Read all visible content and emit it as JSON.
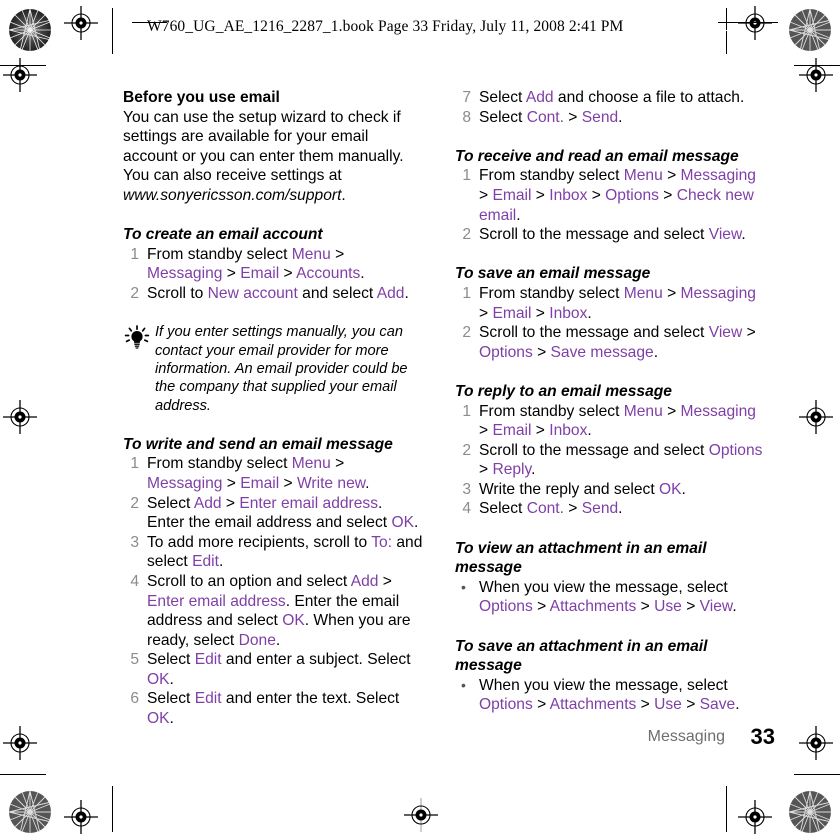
{
  "header": {
    "book_line": "W760_UG_AE_1216_2287_1.book  Page 33  Friday, July 11, 2008  2:41 PM"
  },
  "footer": {
    "chapter": "Messaging",
    "page_number": "33"
  },
  "colors": {
    "ui_term": "#7f3fa6",
    "step_number": "#8c8c8c",
    "chapter_text": "#6e6e6e",
    "body_text": "#000000"
  },
  "icons": {
    "tip": "lightbulb-icon",
    "registration": "registration-target-icon",
    "starburst": "starburst-density-icon"
  },
  "left_column": {
    "section_heading": "Before you use email",
    "intro_1": "You can use the setup wizard to check if settings are available for your email account or you can enter them manually. You can also receive settings at ",
    "intro_url": "www.sonyericsson.com/support",
    "intro_2": ".",
    "proc_1": {
      "title": "To create an email account",
      "steps": [
        {
          "num": "1",
          "parts": [
            {
              "t": "From standby select ",
              "s": "plain"
            },
            {
              "t": "Menu",
              "s": "ui"
            },
            {
              "t": " > ",
              "s": "plain"
            },
            {
              "t": "Messaging",
              "s": "ui"
            },
            {
              "t": " > ",
              "s": "plain"
            },
            {
              "t": "Email",
              "s": "ui"
            },
            {
              "t": " > ",
              "s": "plain"
            },
            {
              "t": "Accounts",
              "s": "ui"
            },
            {
              "t": ".",
              "s": "plain"
            }
          ]
        },
        {
          "num": "2",
          "parts": [
            {
              "t": "Scroll to ",
              "s": "plain"
            },
            {
              "t": "New account",
              "s": "ui"
            },
            {
              "t": " and select ",
              "s": "plain"
            },
            {
              "t": "Add",
              "s": "ui"
            },
            {
              "t": ".",
              "s": "plain"
            }
          ]
        }
      ]
    },
    "tip": "If you enter settings manually, you can contact your email provider for more information. An email provider could be the company that supplied your email address.",
    "proc_2": {
      "title": "To write and send an email message",
      "steps": [
        {
          "num": "1",
          "parts": [
            {
              "t": "From standby select ",
              "s": "plain"
            },
            {
              "t": "Menu",
              "s": "ui"
            },
            {
              "t": " > ",
              "s": "plain"
            },
            {
              "t": "Messaging",
              "s": "ui"
            },
            {
              "t": " > ",
              "s": "plain"
            },
            {
              "t": "Email",
              "s": "ui"
            },
            {
              "t": " > ",
              "s": "plain"
            },
            {
              "t": "Write new",
              "s": "ui"
            },
            {
              "t": ".",
              "s": "plain"
            }
          ]
        },
        {
          "num": "2",
          "parts": [
            {
              "t": "Select ",
              "s": "plain"
            },
            {
              "t": "Add",
              "s": "ui"
            },
            {
              "t": " > ",
              "s": "plain"
            },
            {
              "t": "Enter email address",
              "s": "ui"
            },
            {
              "t": ". Enter the email address and select ",
              "s": "plain"
            },
            {
              "t": "OK",
              "s": "ui"
            },
            {
              "t": ".",
              "s": "plain"
            }
          ]
        },
        {
          "num": "3",
          "parts": [
            {
              "t": "To add more recipients, scroll to ",
              "s": "plain"
            },
            {
              "t": "To:",
              "s": "ui"
            },
            {
              "t": " and select ",
              "s": "plain"
            },
            {
              "t": "Edit",
              "s": "ui"
            },
            {
              "t": ".",
              "s": "plain"
            }
          ]
        },
        {
          "num": "4",
          "parts": [
            {
              "t": "Scroll to an option and select ",
              "s": "plain"
            },
            {
              "t": "Add",
              "s": "ui"
            },
            {
              "t": " > ",
              "s": "plain"
            },
            {
              "t": "Enter email address",
              "s": "ui"
            },
            {
              "t": ". Enter the email address and select ",
              "s": "plain"
            },
            {
              "t": "OK",
              "s": "ui"
            },
            {
              "t": ". When you are ready, select ",
              "s": "plain"
            },
            {
              "t": "Done",
              "s": "ui"
            },
            {
              "t": ".",
              "s": "plain"
            }
          ]
        },
        {
          "num": "5",
          "parts": [
            {
              "t": "Select ",
              "s": "plain"
            },
            {
              "t": "Edit",
              "s": "ui"
            },
            {
              "t": " and enter a subject. Select ",
              "s": "plain"
            },
            {
              "t": "OK",
              "s": "ui"
            },
            {
              "t": ".",
              "s": "plain"
            }
          ]
        },
        {
          "num": "6",
          "parts": [
            {
              "t": "Select ",
              "s": "plain"
            },
            {
              "t": "Edit",
              "s": "ui"
            },
            {
              "t": " and enter the text. Select ",
              "s": "plain"
            },
            {
              "t": "OK",
              "s": "ui"
            },
            {
              "t": ".",
              "s": "plain"
            }
          ]
        }
      ]
    }
  },
  "right_column": {
    "proc_2_cont": {
      "steps": [
        {
          "num": "7",
          "parts": [
            {
              "t": "Select ",
              "s": "plain"
            },
            {
              "t": "Add",
              "s": "ui"
            },
            {
              "t": " and choose a file to attach.",
              "s": "plain"
            }
          ]
        },
        {
          "num": "8",
          "parts": [
            {
              "t": "Select ",
              "s": "plain"
            },
            {
              "t": "Cont.",
              "s": "ui"
            },
            {
              "t": " > ",
              "s": "plain"
            },
            {
              "t": "Send",
              "s": "ui"
            },
            {
              "t": ".",
              "s": "plain"
            }
          ]
        }
      ]
    },
    "proc_3": {
      "title": "To receive and read an email message",
      "steps": [
        {
          "num": "1",
          "parts": [
            {
              "t": "From standby select ",
              "s": "plain"
            },
            {
              "t": "Menu",
              "s": "ui"
            },
            {
              "t": " > ",
              "s": "plain"
            },
            {
              "t": "Messaging",
              "s": "ui"
            },
            {
              "t": " > ",
              "s": "plain"
            },
            {
              "t": "Email",
              "s": "ui"
            },
            {
              "t": " > ",
              "s": "plain"
            },
            {
              "t": "Inbox",
              "s": "ui"
            },
            {
              "t": " > ",
              "s": "plain"
            },
            {
              "t": "Options",
              "s": "ui"
            },
            {
              "t": " > ",
              "s": "plain"
            },
            {
              "t": "Check new email",
              "s": "ui"
            },
            {
              "t": ".",
              "s": "plain"
            }
          ]
        },
        {
          "num": "2",
          "parts": [
            {
              "t": "Scroll to the message and select ",
              "s": "plain"
            },
            {
              "t": "View",
              "s": "ui"
            },
            {
              "t": ".",
              "s": "plain"
            }
          ]
        }
      ]
    },
    "proc_4": {
      "title": "To save an email message",
      "steps": [
        {
          "num": "1",
          "parts": [
            {
              "t": "From standby select ",
              "s": "plain"
            },
            {
              "t": "Menu",
              "s": "ui"
            },
            {
              "t": " > ",
              "s": "plain"
            },
            {
              "t": "Messaging",
              "s": "ui"
            },
            {
              "t": " > ",
              "s": "plain"
            },
            {
              "t": "Email",
              "s": "ui"
            },
            {
              "t": " > ",
              "s": "plain"
            },
            {
              "t": "Inbox",
              "s": "ui"
            },
            {
              "t": ".",
              "s": "plain"
            }
          ]
        },
        {
          "num": "2",
          "parts": [
            {
              "t": "Scroll to the message and select ",
              "s": "plain"
            },
            {
              "t": "View",
              "s": "ui"
            },
            {
              "t": " > ",
              "s": "plain"
            },
            {
              "t": "Options",
              "s": "ui"
            },
            {
              "t": " > ",
              "s": "plain"
            },
            {
              "t": "Save message",
              "s": "ui"
            },
            {
              "t": ".",
              "s": "plain"
            }
          ]
        }
      ]
    },
    "proc_5": {
      "title": "To reply to an email message",
      "steps": [
        {
          "num": "1",
          "parts": [
            {
              "t": "From standby select ",
              "s": "plain"
            },
            {
              "t": "Menu",
              "s": "ui"
            },
            {
              "t": " > ",
              "s": "plain"
            },
            {
              "t": "Messaging",
              "s": "ui"
            },
            {
              "t": " > ",
              "s": "plain"
            },
            {
              "t": "Email",
              "s": "ui"
            },
            {
              "t": " > ",
              "s": "plain"
            },
            {
              "t": "Inbox",
              "s": "ui"
            },
            {
              "t": ".",
              "s": "plain"
            }
          ]
        },
        {
          "num": "2",
          "parts": [
            {
              "t": "Scroll to the message and select ",
              "s": "plain"
            },
            {
              "t": "Options",
              "s": "ui"
            },
            {
              "t": " > ",
              "s": "plain"
            },
            {
              "t": "Reply",
              "s": "ui"
            },
            {
              "t": ".",
              "s": "plain"
            }
          ]
        },
        {
          "num": "3",
          "parts": [
            {
              "t": "Write the reply and select ",
              "s": "plain"
            },
            {
              "t": "OK",
              "s": "ui"
            },
            {
              "t": ".",
              "s": "plain"
            }
          ]
        },
        {
          "num": "4",
          "parts": [
            {
              "t": "Select ",
              "s": "plain"
            },
            {
              "t": "Cont.",
              "s": "ui"
            },
            {
              "t": " > ",
              "s": "plain"
            },
            {
              "t": "Send",
              "s": "ui"
            },
            {
              "t": ".",
              "s": "plain"
            }
          ]
        }
      ]
    },
    "proc_6": {
      "title": "To view an attachment in an email message",
      "bullets": [
        {
          "parts": [
            {
              "t": "When you view the message, select ",
              "s": "plain"
            },
            {
              "t": "Options",
              "s": "ui"
            },
            {
              "t": " > ",
              "s": "plain"
            },
            {
              "t": "Attachments",
              "s": "ui"
            },
            {
              "t": " > ",
              "s": "plain"
            },
            {
              "t": "Use",
              "s": "ui"
            },
            {
              "t": " > ",
              "s": "plain"
            },
            {
              "t": "View",
              "s": "ui"
            },
            {
              "t": ".",
              "s": "plain"
            }
          ]
        }
      ]
    },
    "proc_7": {
      "title": "To save an attachment in an email message",
      "bullets": [
        {
          "parts": [
            {
              "t": "When you view the message, select ",
              "s": "plain"
            },
            {
              "t": "Options",
              "s": "ui"
            },
            {
              "t": " > ",
              "s": "plain"
            },
            {
              "t": "Attachments",
              "s": "ui"
            },
            {
              "t": " > ",
              "s": "plain"
            },
            {
              "t": "Use",
              "s": "ui"
            },
            {
              "t": " > ",
              "s": "plain"
            },
            {
              "t": "Save",
              "s": "ui"
            },
            {
              "t": ".",
              "s": "plain"
            }
          ]
        }
      ]
    }
  }
}
